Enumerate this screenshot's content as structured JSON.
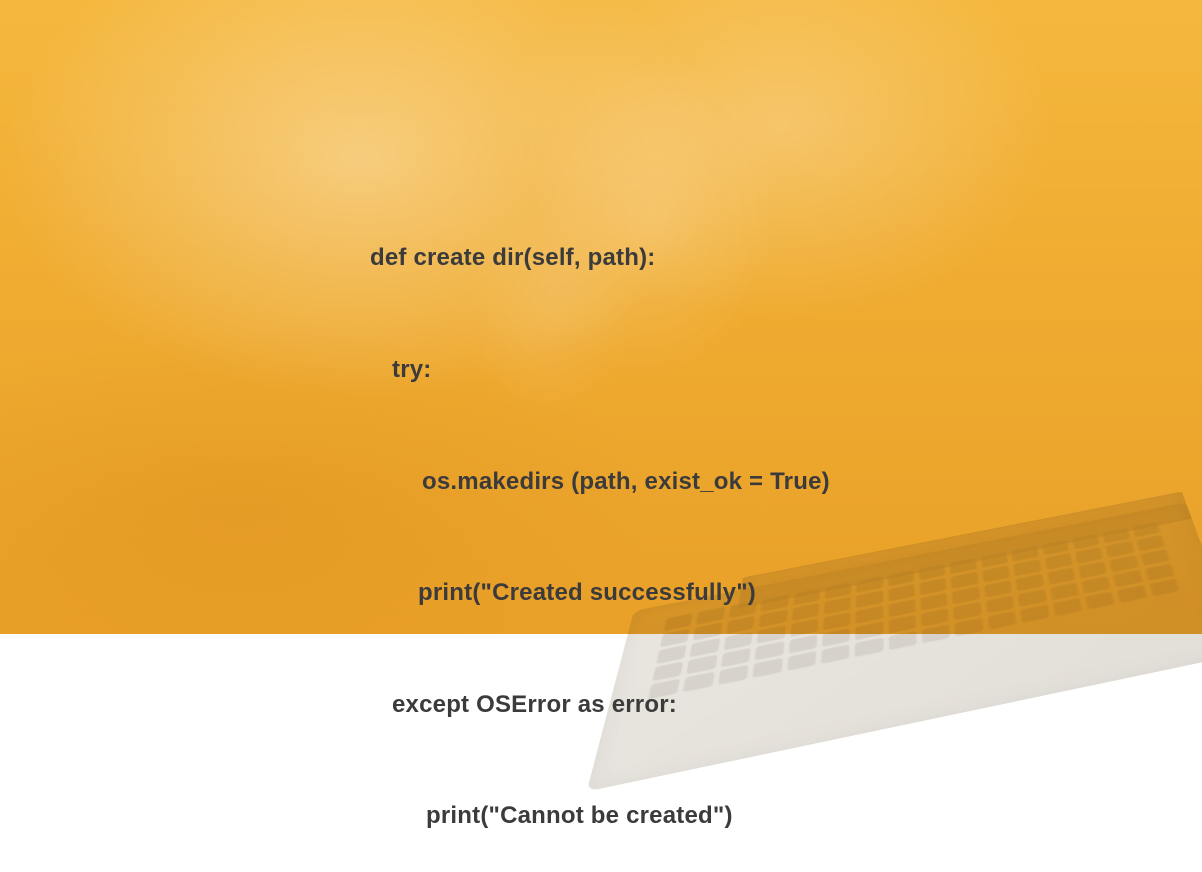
{
  "code": {
    "line1": "def create dir(self, path):",
    "line2": "try:",
    "line3": "os.makedirs (path, exist_ok = True)",
    "line4": "print(\"Created successfully\")",
    "line5": "except OSError as error:",
    "line6": "print(\"Cannot be created\")"
  }
}
